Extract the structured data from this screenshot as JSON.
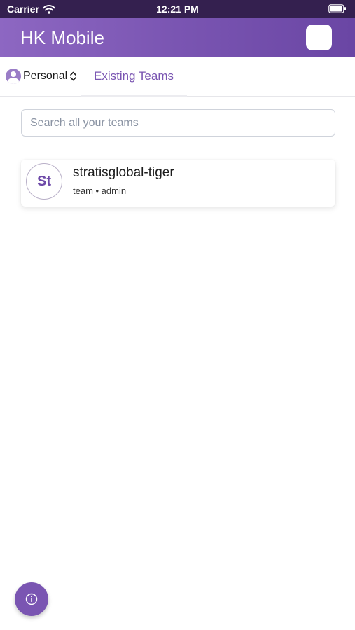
{
  "status_bar": {
    "carrier": "Carrier",
    "time": "12:21 PM"
  },
  "header": {
    "title": "HK Mobile"
  },
  "tabs": {
    "account": "Personal",
    "existing_teams": "Existing Teams"
  },
  "search": {
    "placeholder": "Search all your teams",
    "value": ""
  },
  "teams": [
    {
      "initials": "St",
      "name": "stratisglobal-tiger",
      "meta": "team • admin"
    }
  ],
  "icons": {
    "status": [
      "wifi-icon",
      "battery-icon"
    ],
    "account": [
      "user-avatar-icon",
      "chevron-updown-icon"
    ],
    "fab": "info-icon"
  },
  "colors": {
    "accent": "#7a55b2",
    "status_bar": "#34204f"
  }
}
